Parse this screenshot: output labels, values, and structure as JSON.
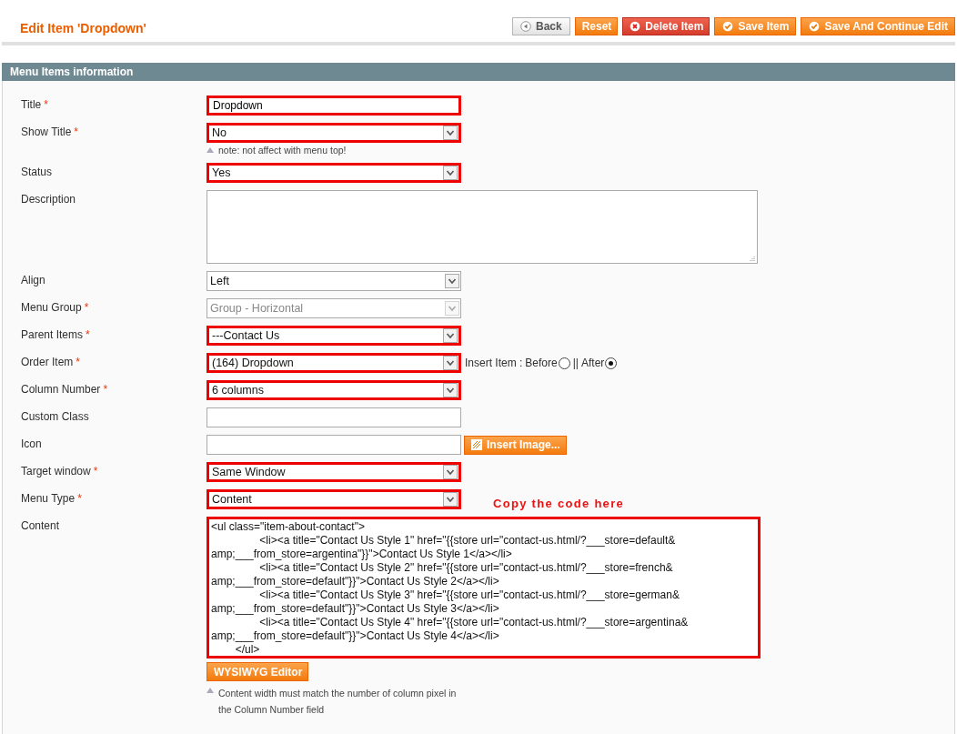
{
  "page_title": "Edit Item 'Dropdown'",
  "buttons": [
    {
      "label": "Back",
      "kind": "back"
    },
    {
      "label": "Reset",
      "kind": "plain"
    },
    {
      "label": "Delete Item",
      "kind": "delete"
    },
    {
      "label": "Save Item",
      "kind": "save"
    },
    {
      "label": "Save And Continue Edit",
      "kind": "save"
    }
  ],
  "section": {
    "title": "Menu Items information"
  },
  "fields": [
    {
      "kind": "text",
      "label": "Title",
      "required_mark": "*",
      "highlighted": true,
      "value": "Dropdown"
    },
    {
      "kind": "select",
      "label": "Show Title",
      "required_mark": "*",
      "highlighted": true,
      "value": "No",
      "disabled": false,
      "note": "note: not affect with menu top!"
    },
    {
      "kind": "select",
      "label": "Status",
      "highlighted": true,
      "value": "Yes",
      "disabled": false
    },
    {
      "kind": "textarea",
      "label": "Description",
      "highlighted": false
    },
    {
      "kind": "select",
      "label": "Align",
      "highlighted": false,
      "value": "Left",
      "disabled": false
    },
    {
      "kind": "select",
      "label": "Menu Group",
      "required_mark": "*",
      "highlighted": false,
      "value": "Group - Horizontal",
      "disabled": true
    },
    {
      "kind": "select",
      "label": "Parent Items",
      "required_mark": "*",
      "highlighted": true,
      "value": "---Contact Us",
      "disabled": false
    },
    {
      "kind": "select",
      "label": "Order Item",
      "required_mark": "*",
      "highlighted": true,
      "value": "(164) Dropdown",
      "disabled": false,
      "insert": {
        "label": "Insert Item :",
        "separator": "||",
        "options": [
          {
            "label": "Before",
            "selected": false
          },
          {
            "label": "After",
            "selected": true
          }
        ]
      }
    },
    {
      "kind": "select",
      "label": "Column Number",
      "required_mark": "*",
      "highlighted": true,
      "value": "6 columns",
      "disabled": false
    },
    {
      "kind": "text",
      "label": "Custom Class",
      "highlighted": false
    },
    {
      "kind": "image",
      "label": "Icon",
      "highlighted": false,
      "button": "Insert Image..."
    },
    {
      "kind": "select",
      "label": "Target window",
      "required_mark": "*",
      "highlighted": true,
      "value": "Same Window",
      "disabled": false
    },
    {
      "kind": "select",
      "label": "Menu Type",
      "required_mark": "*",
      "highlighted": true,
      "value": "Content",
      "disabled": false,
      "annotation": "Copy the code here"
    },
    {
      "kind": "code",
      "label": "Content",
      "highlighted": true,
      "value": "<ul class=\"item-about-contact\">\n\t\t<li><a title=\"Contact Us Style 1\" href=\"{{store url=\"contact-us.html/?___store=default&\namp;___from_store=argentina\"}}\">Contact Us Style 1</a></li>\n\t\t<li><a title=\"Contact Us Style 2\" href=\"{{store url=\"contact-us.html/?___store=french&\namp;___from_store=default\"}}\">Contact Us Style 2</a></li>\n\t\t<li><a title=\"Contact Us Style 3\" href=\"{{store url=\"contact-us.html/?___store=german&\namp;___from_store=default\"}}\">Contact Us Style 3</a></li>\n\t\t<li><a title=\"Contact Us Style 4\" href=\"{{store url=\"contact-us.html/?___store=argentina&\namp;___from_store=default\"}}\">Contact Us Style 4</a></li>\n\t</ul>",
      "button": "WYSIWYG Editor",
      "note_lines": [
        "Content width must match the number of column pixel in",
        "the Column Number field"
      ]
    }
  ]
}
